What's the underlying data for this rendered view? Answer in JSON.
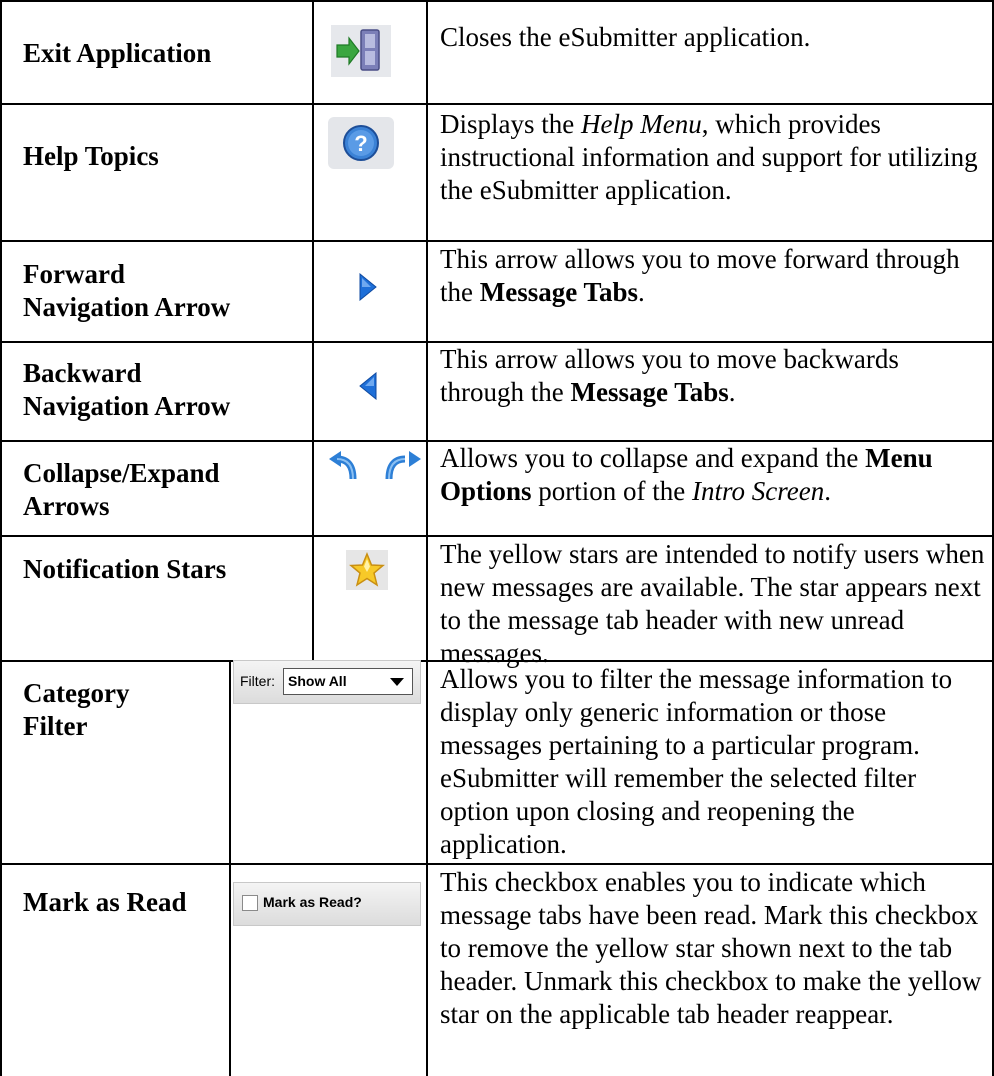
{
  "rows": [
    {
      "title": "Exit Application",
      "icon": "exit-door-icon",
      "desc": [
        "Closes the eSubmitter application."
      ]
    },
    {
      "title": "Help Topics",
      "icon": "help-question-icon",
      "desc": [
        "Displays the ",
        "Help Menu",
        ", which provides instructional information and support for utilizing the eSubmitter application."
      ]
    },
    {
      "title_lines": [
        "Forward",
        "Navigation Arrow"
      ],
      "icon": "forward-arrow-icon",
      "desc": [
        "This arrow allows you to move forward through the ",
        "Message Tabs",
        "."
      ]
    },
    {
      "title_lines": [
        "Backward",
        "Navigation Arrow"
      ],
      "icon": "backward-arrow-icon",
      "desc": [
        "This arrow allows you to move backwards through the ",
        "Message Tabs",
        "."
      ]
    },
    {
      "title_lines": [
        "Collapse/Expand",
        "Arrows"
      ],
      "icon": "collapse-expand-arrows-icon",
      "desc": [
        "Allows you to collapse and expand the ",
        "Menu Options",
        " portion of the ",
        "Intro Screen",
        "."
      ]
    },
    {
      "title": "Notification Stars",
      "icon": "star-icon",
      "desc": [
        "The yellow stars are intended to notify users when new messages are available. The star appears next to the message tab header with new unread messages."
      ]
    },
    {
      "title_lines": [
        "Category",
        "Filter"
      ],
      "widget": {
        "label": "Filter:",
        "selected": "Show All"
      },
      "desc": [
        "Allows you to filter the message information to display only generic information or those messages pertaining to a particular program.  eSubmitter will remember the selected filter option upon closing and reopening the application."
      ]
    },
    {
      "title": "Mark as Read",
      "widget": {
        "label": "Mark as Read?"
      },
      "desc": [
        "This checkbox enables you to indicate which message tabs have been read.  Mark this checkbox to remove the yellow star shown next to the tab header.  Unmark this checkbox to make the yellow star on the applicable tab header reappear."
      ]
    }
  ],
  "colors": {
    "border": "#000000",
    "star_yellow": "#f7c928",
    "arrow_blue": "#1e6fd8",
    "help_blue": "#3b82d6",
    "exit_green": "#3aa640"
  }
}
